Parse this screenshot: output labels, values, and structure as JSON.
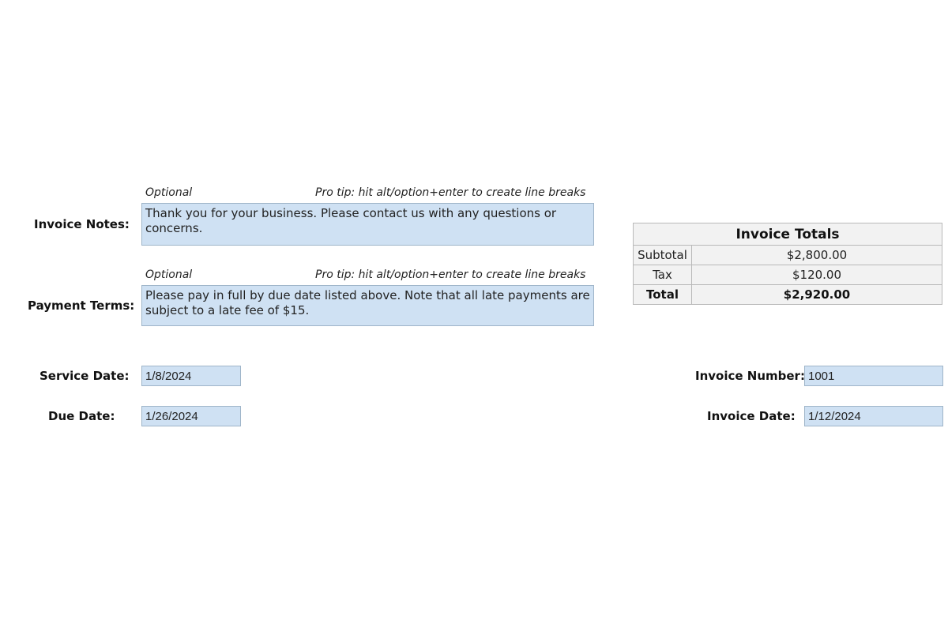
{
  "invoice_notes": {
    "label": "Invoice Notes:",
    "optional_hint": "Optional",
    "pro_tip": "Pro tip:  hit alt/option+enter to create line breaks",
    "value": "Thank you for your business. Please contact us with any questions or concerns."
  },
  "payment_terms": {
    "label": "Payment Terms:",
    "optional_hint": "Optional",
    "pro_tip": "Pro tip:  hit alt/option+enter to create line breaks",
    "value": "Please pay in full by due date listed above. Note that all late payments are subject to a late fee of $15."
  },
  "service_date": {
    "label": "Service Date:",
    "value": "1/8/2024"
  },
  "due_date": {
    "label": "Due Date:",
    "value": "1/26/2024"
  },
  "invoice_number": {
    "label": "Invoice Number:",
    "value": "1001"
  },
  "invoice_date": {
    "label": "Invoice Date:",
    "value": "1/12/2024"
  },
  "totals": {
    "title": "Invoice Totals",
    "rows": [
      {
        "label": "Subtotal",
        "value": "$2,800.00"
      },
      {
        "label": "Tax",
        "value": "$120.00"
      },
      {
        "label": "Total",
        "value": "$2,920.00"
      }
    ]
  },
  "colors": {
    "input_fill": "#cfe1f3",
    "input_border": "#9fb5c9",
    "table_fill": "#f2f2f2",
    "table_border": "#b9b9b9"
  }
}
